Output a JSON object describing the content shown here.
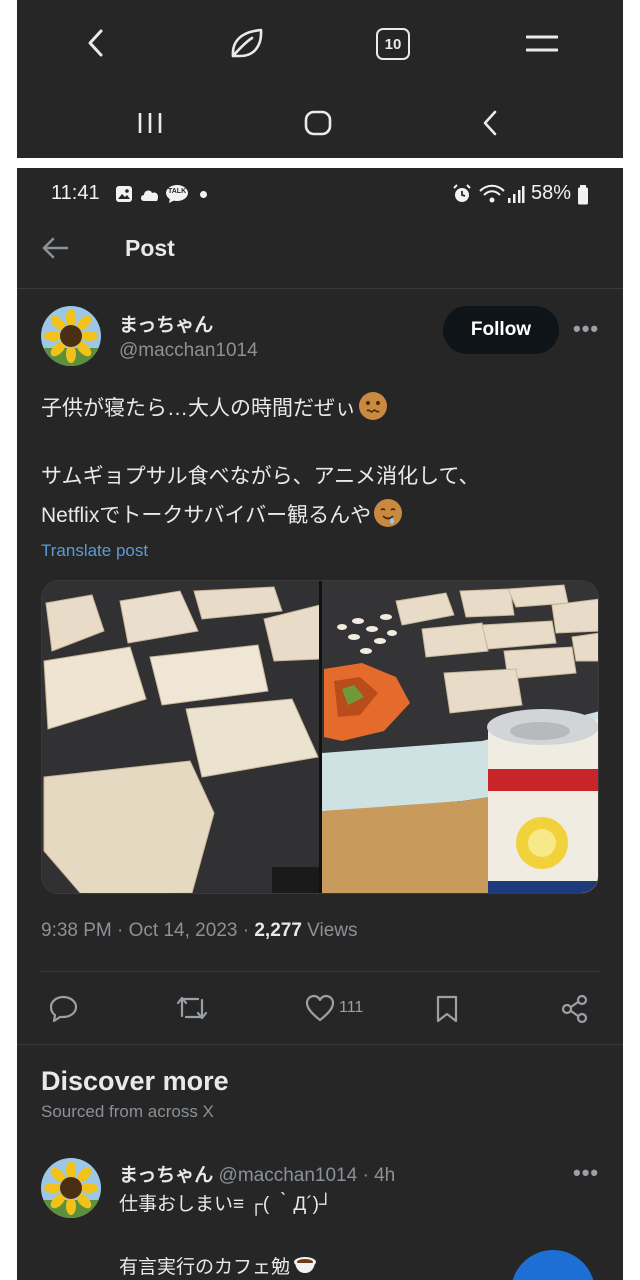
{
  "browser_chrome": {
    "tab_count": "10"
  },
  "status_bar": {
    "time": "11:41",
    "notification_badge": "TALK",
    "battery": "58%"
  },
  "header": {
    "title": "Post"
  },
  "post": {
    "author_name": "まっちゃん",
    "author_handle": "@macchan1014",
    "follow_label": "Follow",
    "text_line1": "子供が寝たら…大人の時間だぜぃ",
    "text_line2": "サムギョプサル食べながら、アニメ消化して、",
    "text_line3": "Netflixでトークサバイバー観るんや",
    "translate_label": "Translate post",
    "time": "9:38 PM",
    "date": "Oct 14, 2023",
    "views_count": "2,277",
    "views_label": "Views",
    "like_count": "111"
  },
  "discover": {
    "title": "Discover more",
    "subtitle": "Sourced from across X"
  },
  "suggested_post": {
    "author_name": "まっちゃん",
    "author_handle": "@macchan1014",
    "age": "4h",
    "text_line1": "仕事おしまい≡ ┌( ｀Д´)┘",
    "text_line2": "有言実行のカフェ勉"
  },
  "colors": {
    "background": "#262626",
    "link": "#5b9bd5",
    "muted": "#8b9197",
    "follow_bg": "#0f1419",
    "fab": "#1d6fd6"
  }
}
